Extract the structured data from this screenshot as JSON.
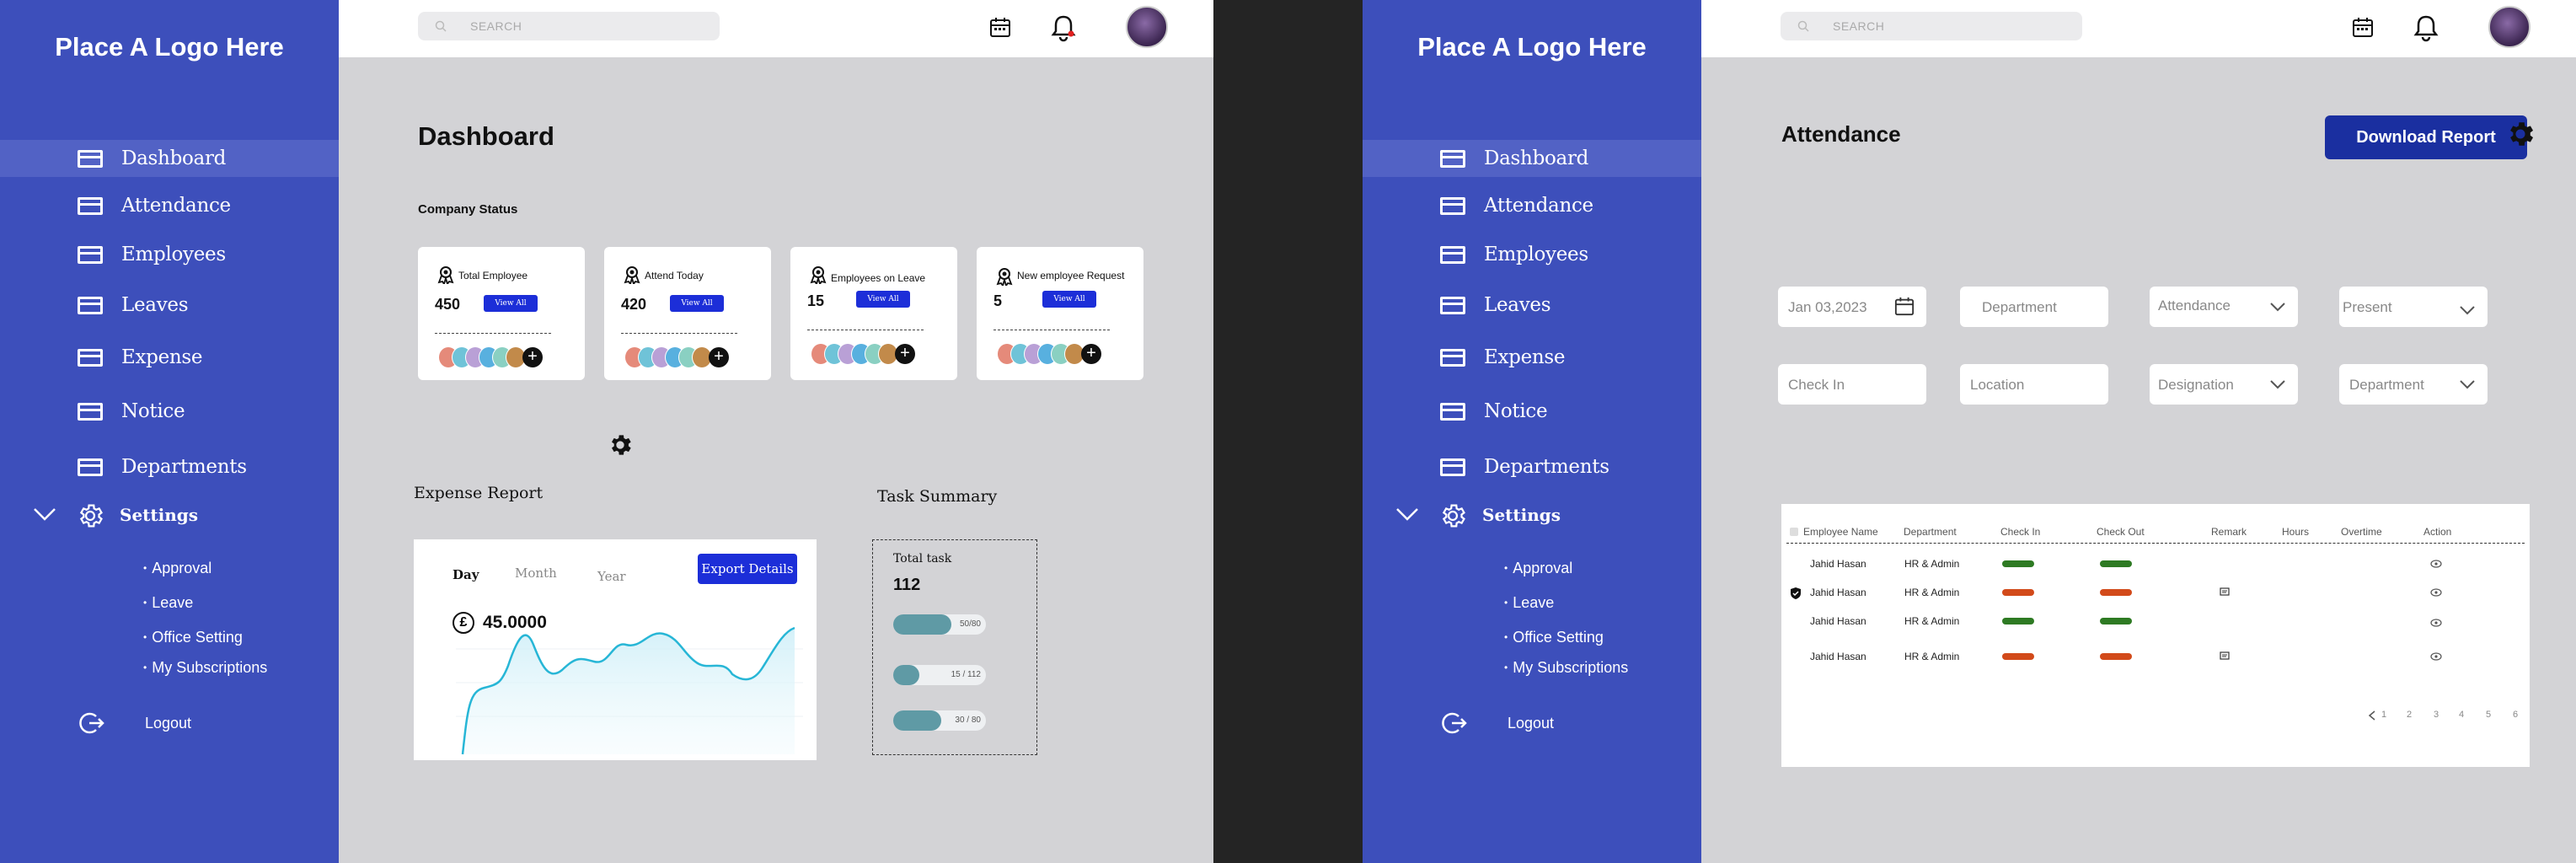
{
  "left": {
    "logo": "Place A Logo Here",
    "search_placeholder": "SEARCH",
    "nav": [
      "Dashboard",
      "Attendance",
      "Employees",
      "Leaves",
      "Expense",
      "Notice",
      "Departments"
    ],
    "settings_label": "Settings",
    "settings_sub": [
      "Approval",
      "Leave",
      "Office Setting",
      "My Subscriptions"
    ],
    "logout": "Logout",
    "page_title": "Dashboard",
    "company_status": "Company Status",
    "cards": [
      {
        "title": "Total Employee",
        "value": "450",
        "button": "View All"
      },
      {
        "title": "Attend Today",
        "value": "420",
        "button": "View All"
      },
      {
        "title": "Employees on Leave",
        "value": "15",
        "button": "View All"
      },
      {
        "title": "New employee Request",
        "value": "5",
        "button": "View All"
      }
    ],
    "expense_report": {
      "heading": "Expense Report",
      "tabs": [
        "Day",
        "Month",
        "Year"
      ],
      "active_tab": "Day",
      "export_button": "Export Details",
      "currency_symbol": "£",
      "amount": "45.0000"
    },
    "task_summary": {
      "heading": "Task Summary",
      "title": "Total task",
      "total": "112",
      "bars": [
        {
          "label": "50/80",
          "fraction": 0.63
        },
        {
          "label": "15 / 112",
          "fraction": 0.28
        },
        {
          "label": "30 / 80",
          "fraction": 0.52
        }
      ]
    }
  },
  "right": {
    "logo": "Place A Logo Here",
    "search_placeholder": "SEARCH",
    "nav": [
      "Dashboard",
      "Attendance",
      "Employees",
      "Leaves",
      "Expense",
      "Notice",
      "Departments"
    ],
    "settings_label": "Settings",
    "settings_sub": [
      "Approval",
      "Leave",
      "Office Setting",
      "My Subscriptions"
    ],
    "logout": "Logout",
    "page_title": "Attendance",
    "download_button": "Download Report",
    "filters": {
      "date": "Jan 03,2023",
      "department": "Department",
      "attendance": "Attendance",
      "present": "Present",
      "check_in": "Check In",
      "location": "Location",
      "designation": "Designation",
      "department2": "Department"
    },
    "table": {
      "headers": [
        "Employee Name",
        "Department",
        "Check In",
        "Check Out",
        "Remark",
        "Hours",
        "Overtime",
        "Action"
      ],
      "rows": [
        {
          "name": "Jahid Hasan",
          "dept": "HR & Admin",
          "in": "green",
          "out": "green",
          "remark": ""
        },
        {
          "name": "Jahid Hasan",
          "dept": "HR & Admin",
          "in": "red",
          "out": "red",
          "remark": "doc"
        },
        {
          "name": "Jahid Hasan",
          "dept": "HR & Admin",
          "in": "green",
          "out": "green",
          "remark": ""
        },
        {
          "name": "Jahid Hasan",
          "dept": "HR & Admin",
          "in": "red",
          "out": "red",
          "remark": "doc"
        }
      ],
      "pages": [
        "1",
        "2",
        "3",
        "4",
        "5",
        "6"
      ]
    }
  },
  "colors": {
    "sidebar": "#3d4fbb",
    "primary_button": "#1c2ed8",
    "download_button": "#1a2fa0",
    "progress": "#5f9aa5",
    "chart_line": "#27b6d6"
  }
}
